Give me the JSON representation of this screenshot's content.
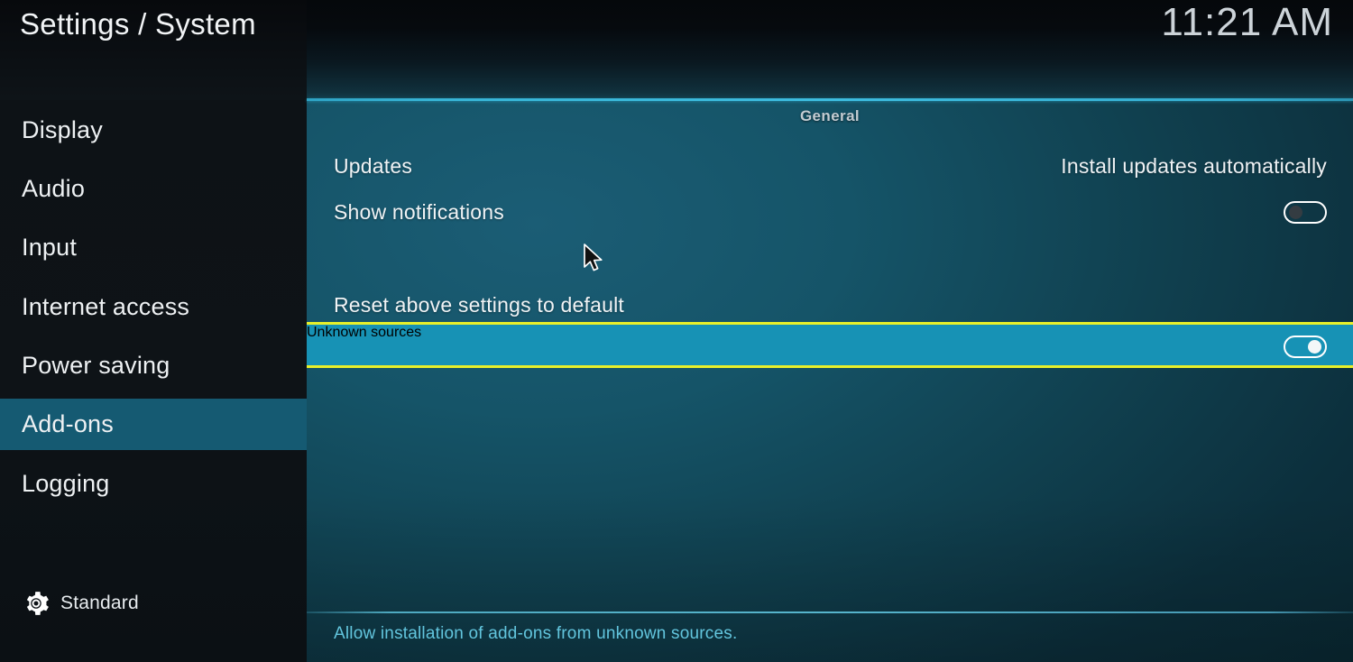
{
  "header": {
    "title": "Settings / System",
    "clock": "11:21 AM"
  },
  "sidebar": {
    "items": [
      {
        "label": "Display",
        "selected": false
      },
      {
        "label": "Audio",
        "selected": false
      },
      {
        "label": "Input",
        "selected": false
      },
      {
        "label": "Internet access",
        "selected": false
      },
      {
        "label": "Power saving",
        "selected": false
      },
      {
        "label": "Add-ons",
        "selected": true
      },
      {
        "label": "Logging",
        "selected": false
      }
    ],
    "profile": {
      "icon": "gear-icon",
      "label": "Standard"
    }
  },
  "main": {
    "group_header": "General",
    "rows": [
      {
        "label": "Updates",
        "value": "Install updates automatically",
        "control": "text",
        "focused": false
      },
      {
        "label": "Show notifications",
        "value": "",
        "control": "toggle",
        "state": "off",
        "focused": false
      },
      {
        "label": "Unknown sources",
        "value": "",
        "control": "toggle",
        "state": "on",
        "focused": true
      },
      {
        "label": "Reset above settings to default",
        "value": "",
        "control": "none",
        "focused": false
      }
    ],
    "help_text": "Allow installation of add-ons from unknown sources."
  },
  "colors": {
    "focus_border": "#e8f02a",
    "focus_fill": "#1792b5",
    "sidebar_selected": "#155a72",
    "accent_rule": "#3dbcdf",
    "help_text": "#62c5dd"
  }
}
